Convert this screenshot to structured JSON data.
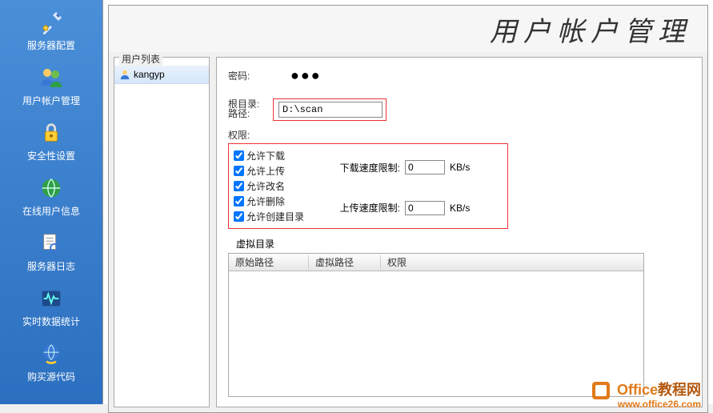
{
  "title": "用户帐户管理",
  "sidebar": {
    "items": [
      {
        "label": "服务器配置"
      },
      {
        "label": "用户帐户管理"
      },
      {
        "label": "安全性设置"
      },
      {
        "label": "在线用户信息"
      },
      {
        "label": "服务器日志"
      },
      {
        "label": "实时数据统计"
      },
      {
        "label": "购买源代码"
      }
    ]
  },
  "userList": {
    "title": "用户列表",
    "items": [
      {
        "name": "kangyp"
      }
    ]
  },
  "form": {
    "passwordLabel": "密码:",
    "passwordMask": "●●●",
    "rootDirLabel": "根目录:",
    "pathLabel": "路径:",
    "pathValue": "D:\\scan",
    "permLabel": "权限:",
    "perms": {
      "download": "允许下载",
      "upload": "允许上传",
      "rename": "允许改名",
      "delete": "允许删除",
      "createDir": "允许创建目录"
    },
    "speed": {
      "downloadLabel": "下载速度限制:",
      "downloadValue": "0",
      "downloadUnit": "KB/s",
      "uploadLabel": "上传速度限制:",
      "uploadValue": "0",
      "uploadUnit": "KB/s"
    },
    "virtualDir": {
      "title": "虚拟目录",
      "cols": {
        "origPath": "原始路径",
        "virtPath": "虚拟路径",
        "perm": "权限"
      }
    }
  },
  "watermark": {
    "brand1": "Office",
    "brand2": "教程网",
    "url": "www.office26.com"
  }
}
